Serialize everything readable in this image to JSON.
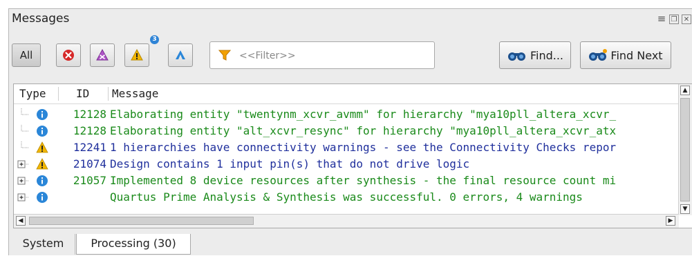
{
  "panel": {
    "title": "Messages",
    "window_controls": [
      "menu-icon",
      "float-icon",
      "close-icon"
    ]
  },
  "toolbar": {
    "all_label": "All",
    "error_icon": "error-icon",
    "critical_warning_icon": "critical-warning-icon",
    "warning_icon": "warning-icon",
    "warning_badge": "3",
    "suppressed_icon": "suppressed-icon",
    "filter_placeholder": "<<Filter>>",
    "find_label": "Find...",
    "find_next_label": "Find Next"
  },
  "table": {
    "columns": [
      "Type",
      "ID",
      "Message"
    ],
    "rows": [
      {
        "type": "info",
        "id": "12128",
        "message": "Elaborating entity \"twentynm_xcvr_avmm\" for hierarchy \"mya10pll_altera_xcvr_",
        "color": "green",
        "expandable": false
      },
      {
        "type": "info",
        "id": "12128",
        "message": "Elaborating entity \"alt_xcvr_resync\" for hierarchy \"mya10pll_altera_xcvr_atx",
        "color": "green",
        "expandable": false
      },
      {
        "type": "warning",
        "id": "12241",
        "message": "1 hierarchies have connectivity warnings - see the Connectivity Checks repor",
        "color": "blue",
        "expandable": false
      },
      {
        "type": "warning",
        "id": "21074",
        "message": "Design contains 1 input pin(s) that do not drive logic",
        "color": "blue",
        "expandable": true
      },
      {
        "type": "info",
        "id": "21057",
        "message": "Implemented 8 device resources after synthesis - the final resource count mi",
        "color": "green",
        "expandable": true
      },
      {
        "type": "info",
        "id": "",
        "message": "Quartus Prime Analysis & Synthesis was successful. 0 errors, 4 warnings",
        "color": "green",
        "expandable": true
      }
    ]
  },
  "tabs": [
    {
      "label": "System",
      "active": false
    },
    {
      "label": "Processing (30)",
      "active": true
    }
  ],
  "colors": {
    "info_text": "#1a8a1a",
    "warning_text": "#1f2f9c",
    "info_icon": "#2a86d8",
    "warning_icon": "#f2b600",
    "error_icon": "#d62828"
  }
}
